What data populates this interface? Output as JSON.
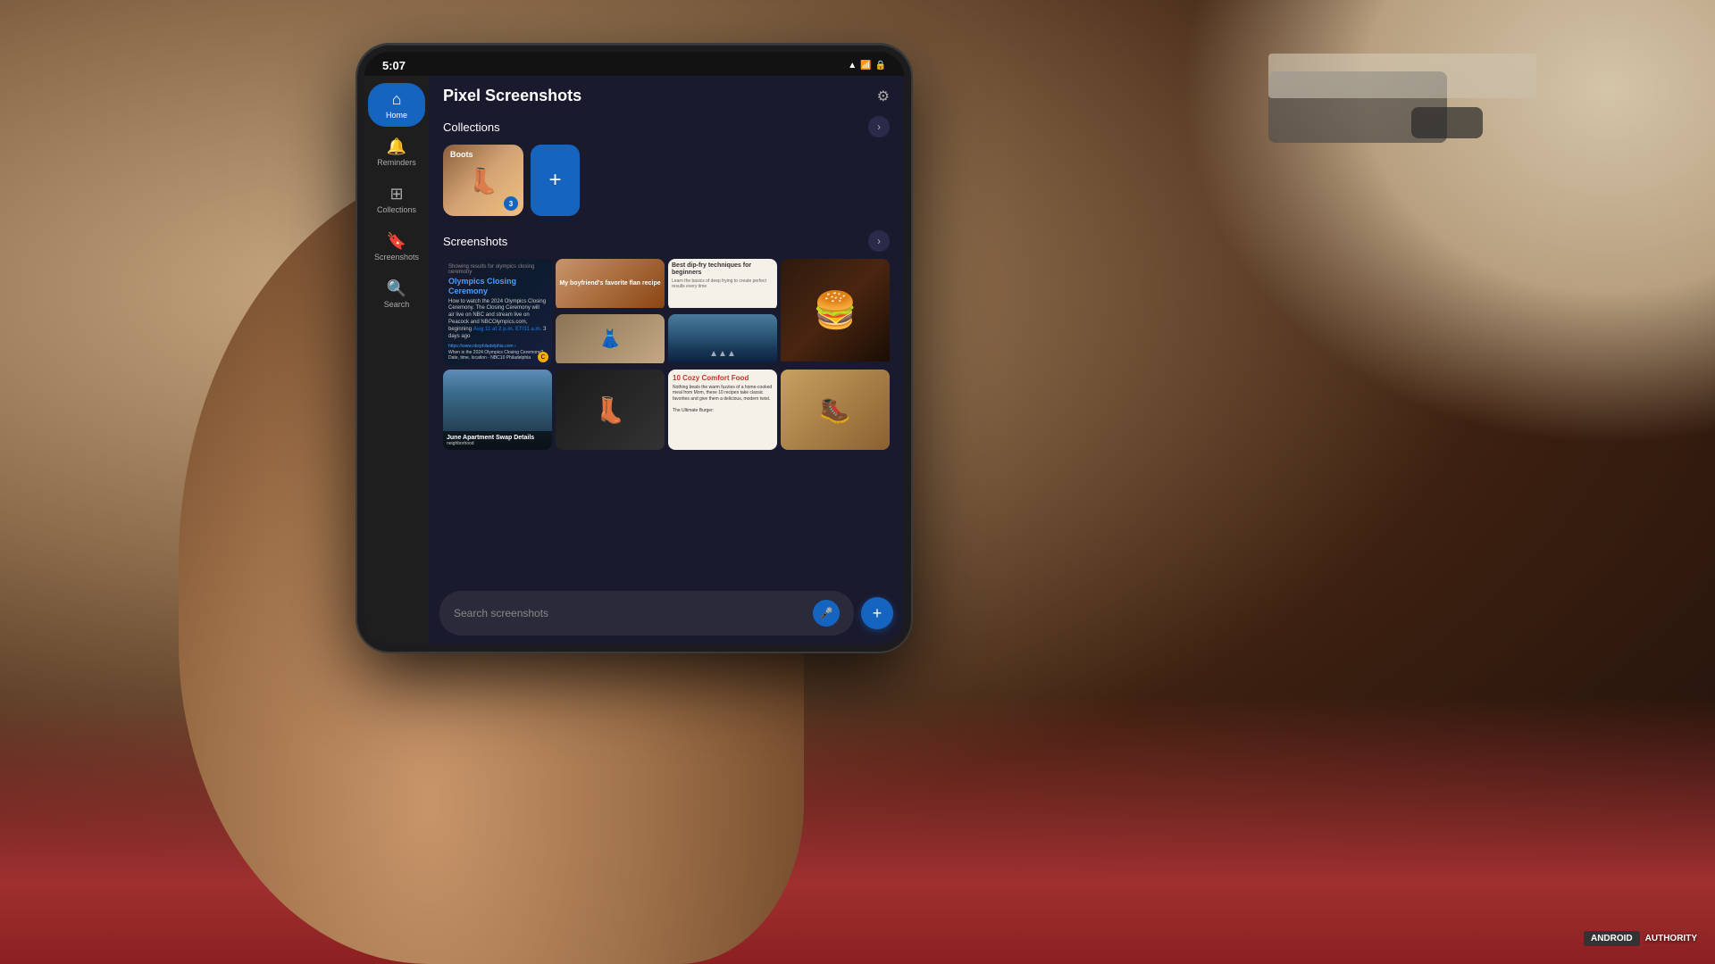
{
  "background": {
    "description": "Room with table, keyboard, and brick floor"
  },
  "phone": {
    "status_bar": {
      "time": "5:07",
      "wifi_icon": "wifi",
      "signal_icon": "signal",
      "battery_icon": "battery"
    },
    "app_title": "Pixel Screenshots",
    "settings_icon": "⚙",
    "sidebar": {
      "items": [
        {
          "label": "Home",
          "icon": "⌂",
          "active": true
        },
        {
          "label": "Reminders",
          "icon": "🔔",
          "active": false
        },
        {
          "label": "Collections",
          "icon": "⊞",
          "active": false
        },
        {
          "label": "Screenshots",
          "icon": "🔖",
          "active": false
        },
        {
          "label": "Search",
          "icon": "🔍",
          "active": false
        }
      ]
    },
    "collections_section": {
      "title": "Collections",
      "arrow": ">",
      "cards": [
        {
          "name": "Boots",
          "count": "3",
          "thumbnail": "boots"
        }
      ],
      "add_button_label": "+"
    },
    "screenshots_section": {
      "title": "Screenshots",
      "arrow": ">",
      "items": [
        {
          "type": "olympics",
          "title": "Olympics Closing Ceremony",
          "subtitle": "How to watch the 2024 Olympics Closing Ceremony",
          "tall": true
        },
        {
          "type": "food1",
          "label": "My boyfriend's favorite flan recipe"
        },
        {
          "type": "recipe",
          "title": "Best dip-fry techniques for beginners"
        },
        {
          "type": "burger",
          "emoji": "🍔"
        },
        {
          "type": "fashion",
          "emoji": "👗"
        },
        {
          "type": "mountains",
          "label": ""
        },
        {
          "type": "apartment",
          "title": "June Apartment Swap Details",
          "subtitle": "neighborhood"
        },
        {
          "type": "boots",
          "emoji": "👢"
        },
        {
          "type": "comfort",
          "title": "10 Cozy Comfort Food",
          "body": "Nothing beats the warm fuzzies of a home-cooked meal from Mom"
        },
        {
          "type": "cowboy",
          "emoji": "🥾"
        }
      ]
    },
    "search_bar": {
      "placeholder": "Search screenshots",
      "mic_icon": "🎤",
      "fab_icon": "+"
    }
  },
  "watermark": {
    "android": "ANDROID",
    "authority": "AUTHORITY"
  }
}
